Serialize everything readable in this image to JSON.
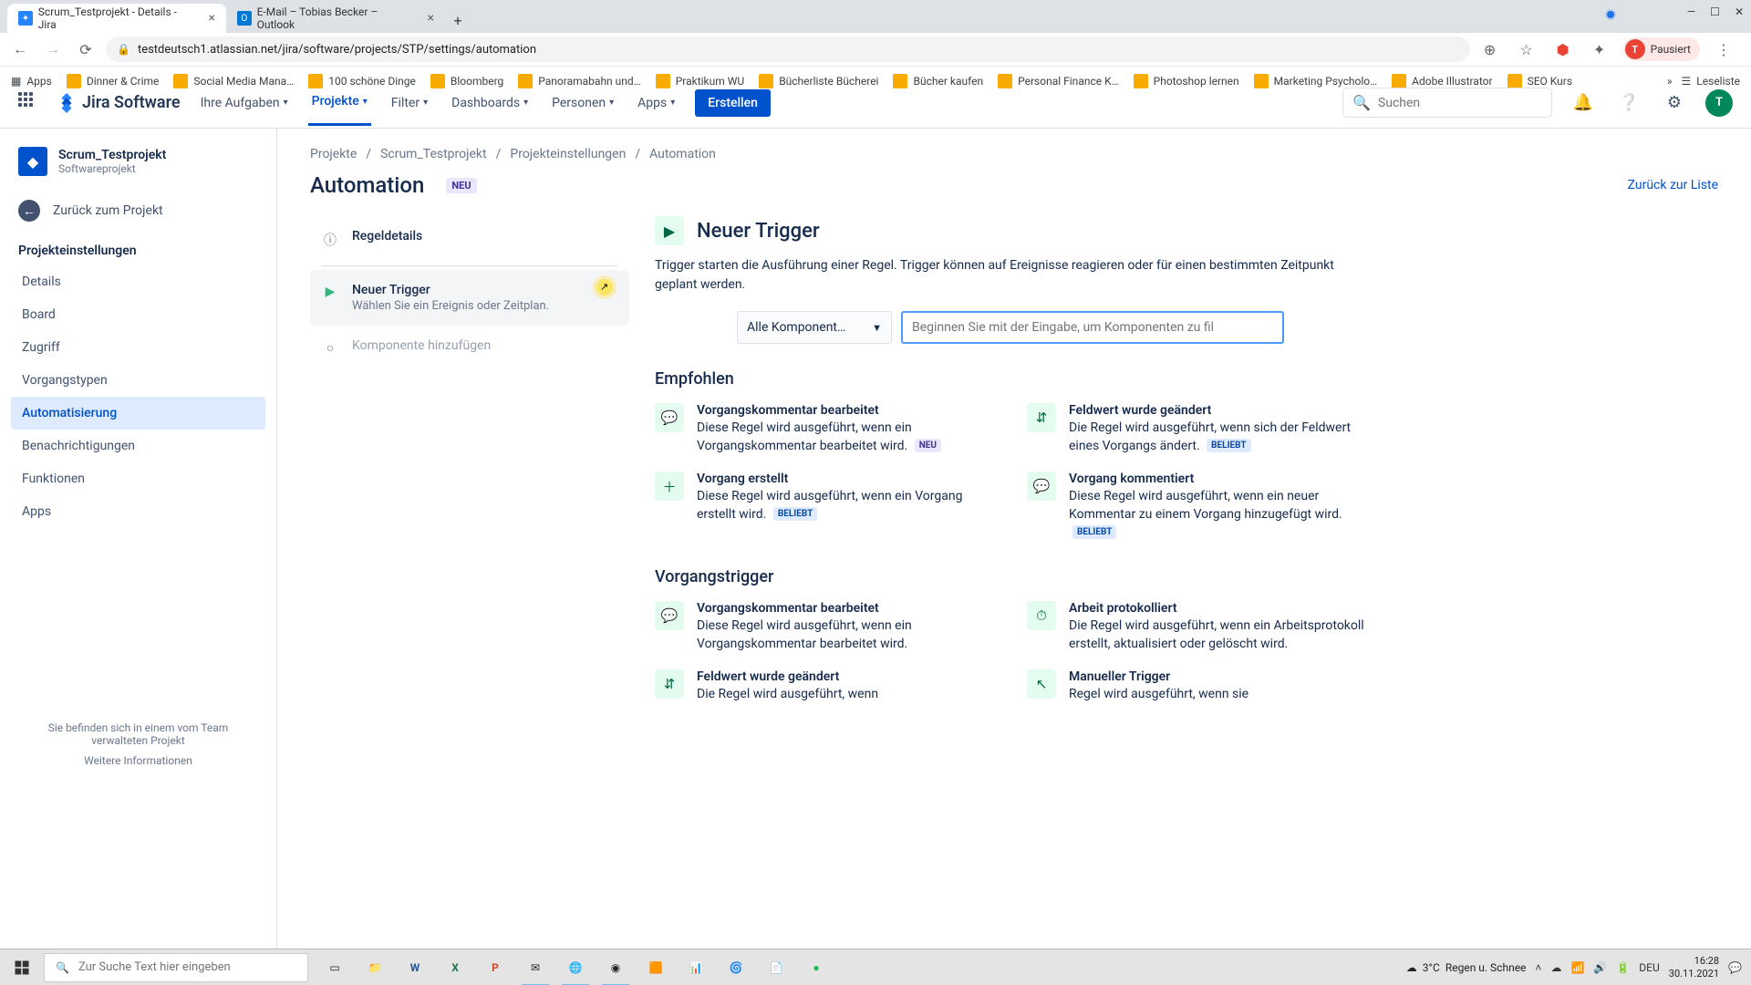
{
  "browser": {
    "tabs": [
      {
        "title": "Scrum_Testprojekt - Details - Jira",
        "favicon_bg": "#2684ff",
        "favicon_text": "✦"
      },
      {
        "title": "E-Mail – Tobias Becker – Outlook",
        "favicon_bg": "#0078d4",
        "favicon_text": "O"
      }
    ],
    "url": "testdeutsch1.atlassian.net/jira/software/projects/STP/settings/automation",
    "profile_status": "Pausiert",
    "profile_initial": "T",
    "bookmarks": [
      "Apps",
      "Dinner & Crime",
      "Social Media Mana…",
      "100 schöne Dinge",
      "Bloomberg",
      "Panoramabahn und…",
      "Praktikum WU",
      "Bücherliste Bücherei",
      "Bücher kaufen",
      "Personal Finance K…",
      "Photoshop lernen",
      "Marketing Psycholo…",
      "Adobe Illustrator",
      "SEO Kurs"
    ],
    "reading_list": "Leseliste"
  },
  "jira_nav": {
    "product": "Jira Software",
    "items": [
      "Ihre Aufgaben",
      "Projekte",
      "Filter",
      "Dashboards",
      "Personen",
      "Apps"
    ],
    "active_index": 1,
    "create": "Erstellen",
    "search_placeholder": "Suchen",
    "avatar_initial": "T"
  },
  "sidebar": {
    "project_name": "Scrum_Testprojekt",
    "project_type": "Softwareprojekt",
    "back_link": "Zurück zum Projekt",
    "section": "Projekteinstellungen",
    "items": [
      "Details",
      "Board",
      "Zugriff",
      "Vorgangstypen",
      "Automatisierung",
      "Benachrichtigungen",
      "Funktionen",
      "Apps"
    ],
    "selected_index": 4,
    "footer_text": "Sie befinden sich in einem vom Team verwalteten Projekt",
    "footer_link": "Weitere Informationen"
  },
  "breadcrumb": [
    "Projekte",
    "Scrum_Testprojekt",
    "Projekteinstellungen",
    "Automation"
  ],
  "page": {
    "title": "Automation",
    "badge": "NEU",
    "back_to_list": "Zurück zur Liste"
  },
  "steps": {
    "rule_details": "Regeldetails",
    "new_trigger_title": "Neuer Trigger",
    "new_trigger_sub": "Wählen Sie ein Ereignis oder Zeitplan.",
    "add_component": "Komponente hinzufügen"
  },
  "panel": {
    "title": "Neuer Trigger",
    "desc": "Trigger starten die Ausführung einer Regel. Trigger können auf Ereignisse reagieren oder für einen bestimmten Zeitpunkt geplant werden.",
    "dropdown": "Alle Komponent…",
    "filter_placeholder": "Beginnen Sie mit der Eingabe, um Komponenten zu fil",
    "section_recommended": "Empfohlen",
    "section_issue": "Vorgangstrigger",
    "badge_neu": "NEU",
    "badge_pop": "BELIEBT"
  },
  "triggers_recommended": [
    {
      "title": "Vorgangskommentar bearbeitet",
      "desc": "Diese Regel wird ausgeführt, wenn ein Vorgangskommentar bearbeitet wird.",
      "badge": "neu",
      "icon": "💬"
    },
    {
      "title": "Feldwert wurde geändert",
      "desc": "Die Regel wird ausgeführt, wenn sich der Feldwert eines Vorgangs ändert.",
      "badge": "pop",
      "icon": "⇵"
    },
    {
      "title": "Vorgang erstellt",
      "desc": "Diese Regel wird ausgeführt, wenn ein Vorgang erstellt wird.",
      "badge": "pop",
      "icon": "＋"
    },
    {
      "title": "Vorgang kommentiert",
      "desc": "Diese Regel wird ausgeführt, wenn ein neuer Kommentar zu einem Vorgang hinzugefügt wird.",
      "badge": "pop",
      "icon": "💬"
    }
  ],
  "triggers_issue": [
    {
      "title": "Vorgangskommentar bearbeitet",
      "desc": "Diese Regel wird ausgeführt, wenn ein Vorgangskommentar bearbeitet wird.",
      "icon": "💬"
    },
    {
      "title": "Arbeit protokolliert",
      "desc": "Die Regel wird ausgeführt, wenn ein Arbeitsprotokoll erstellt, aktualisiert oder gelöscht wird.",
      "icon": "⏱"
    },
    {
      "title": "Feldwert wurde geändert",
      "desc": "Die Regel wird ausgeführt, wenn",
      "icon": "⇵"
    },
    {
      "title": "Manueller Trigger",
      "desc": "Regel wird ausgeführt, wenn sie",
      "icon": "↖"
    }
  ],
  "taskbar": {
    "search_placeholder": "Zur Suche Text hier eingeben",
    "weather_temp": "3°C",
    "weather_text": "Regen u. Schnee",
    "time": "16:28",
    "date": "30.11.2021",
    "lang": "DEU"
  }
}
